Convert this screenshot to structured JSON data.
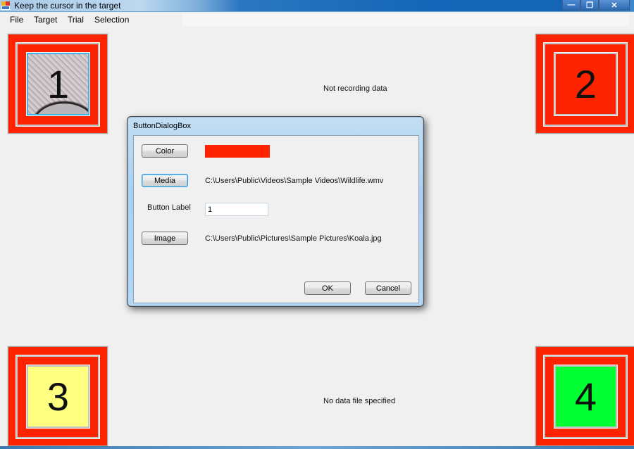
{
  "window": {
    "title": "Keep the cursor in the target",
    "controls": {
      "minimize": "—",
      "maximize": "❐",
      "close": "✕"
    }
  },
  "menu": [
    "File",
    "Target",
    "Trial",
    "Selection"
  ],
  "targets": [
    {
      "label": "1",
      "fill": "image",
      "fill_color": "#b9b5b8"
    },
    {
      "label": "2",
      "fill": "red",
      "fill_color": "#ff2400"
    },
    {
      "label": "3",
      "fill": "yellow",
      "fill_color": "#ffff80"
    },
    {
      "label": "4",
      "fill": "green",
      "fill_color": "#00ff33"
    }
  ],
  "colors": {
    "frame": "#ff2400"
  },
  "status": {
    "recording": "Not recording data",
    "data_file": "No data file specified"
  },
  "dialog": {
    "title": "ButtonDialogBox",
    "color_button": "Color",
    "color_value": "#ff2400",
    "media_button": "Media",
    "media_path": "C:\\Users\\Public\\Videos\\Sample Videos\\Wildlife.wmv",
    "button_label_label": "Button Label",
    "button_label_value": "1",
    "image_button": "Image",
    "image_path": "C:\\Users\\Public\\Pictures\\Sample Pictures\\Koala.jpg",
    "ok": "OK",
    "cancel": "Cancel"
  }
}
